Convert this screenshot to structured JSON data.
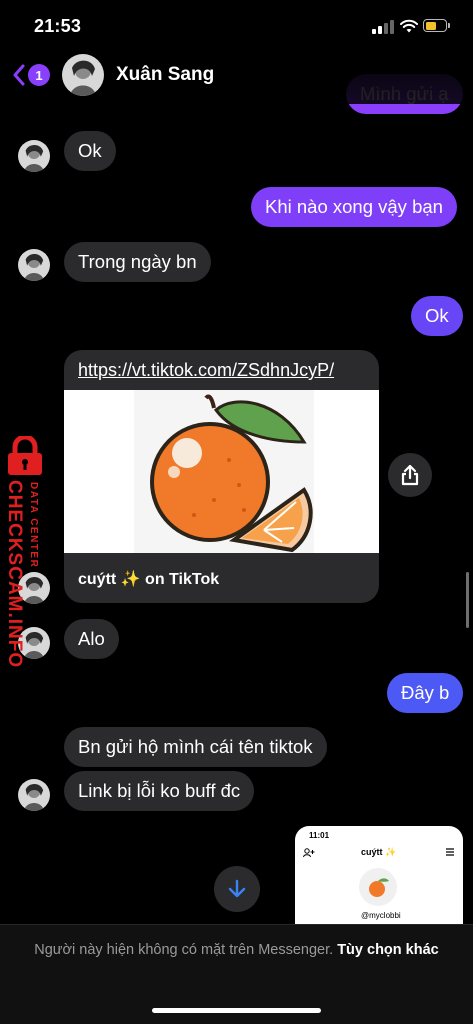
{
  "status_bar": {
    "time": "21:53"
  },
  "header": {
    "back_badge": "1",
    "contact_name": "Xuân Sang",
    "partial_top_message": "Mình gửi ạ"
  },
  "messages": [
    {
      "side": "in",
      "text": "Ok"
    },
    {
      "side": "out",
      "text": "Khi nào xong vậy bạn"
    },
    {
      "side": "in",
      "text": "Trong ngày bn"
    },
    {
      "side": "out",
      "text": "Ok"
    },
    {
      "side": "in",
      "type": "link",
      "url": "https://vt.tiktok.com/ZSdhnJcyP/",
      "title": "cuýtt ✨ on TikTok"
    },
    {
      "side": "in",
      "text": "Alo"
    },
    {
      "side": "out",
      "text": "Đây b"
    },
    {
      "side": "in",
      "text": "Bn gửi hộ mình cái tên tiktok"
    },
    {
      "side": "in",
      "text": "Link bị lỗi ko buff đc"
    }
  ],
  "watermark": {
    "main": "CHECKSCAM.INFO",
    "sub": "DATA CENTER"
  },
  "thumbnail": {
    "time": "11:01",
    "username": "cuýtt ✨",
    "handle": "@myclobbi"
  },
  "footer": {
    "notice": "Người này hiện không có mặt trên Messenger.",
    "action": "Tùy chọn khác"
  },
  "colors": {
    "outgoing_bubble": "#7f3ef7",
    "outgoing_bubble_blue": "#4d59f4",
    "incoming_bubble": "#2b2b2d",
    "watermark": "#e02020"
  }
}
